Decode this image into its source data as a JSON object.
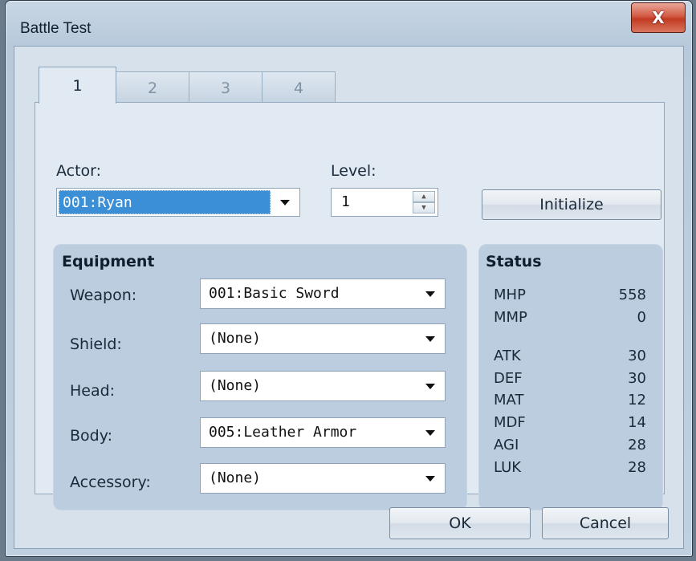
{
  "window": {
    "title": "Battle Test",
    "close_label": "X"
  },
  "tabs": [
    {
      "label": "1"
    },
    {
      "label": "2"
    },
    {
      "label": "3"
    },
    {
      "label": "4"
    }
  ],
  "actor": {
    "label": "Actor:",
    "value": "001:Ryan"
  },
  "level": {
    "label": "Level:",
    "value": "1"
  },
  "initialize_label": "Initialize",
  "equipment": {
    "title": "Equipment",
    "rows": [
      {
        "label": "Weapon:",
        "value": "001:Basic Sword"
      },
      {
        "label": "Shield:",
        "value": "(None)"
      },
      {
        "label": "Head:",
        "value": "(None)"
      },
      {
        "label": "Body:",
        "value": "005:Leather Armor"
      },
      {
        "label": "Accessory:",
        "value": "(None)"
      }
    ]
  },
  "status": {
    "title": "Status",
    "stats": [
      {
        "name": "MHP",
        "value": "558"
      },
      {
        "name": "MMP",
        "value": "0"
      },
      {
        "name": "ATK",
        "value": "30"
      },
      {
        "name": "DEF",
        "value": "30"
      },
      {
        "name": "MAT",
        "value": "12"
      },
      {
        "name": "MDF",
        "value": "14"
      },
      {
        "name": "AGI",
        "value": "28"
      },
      {
        "name": "LUK",
        "value": "28"
      }
    ]
  },
  "buttons": {
    "ok_label": "OK",
    "cancel_label": "Cancel"
  }
}
